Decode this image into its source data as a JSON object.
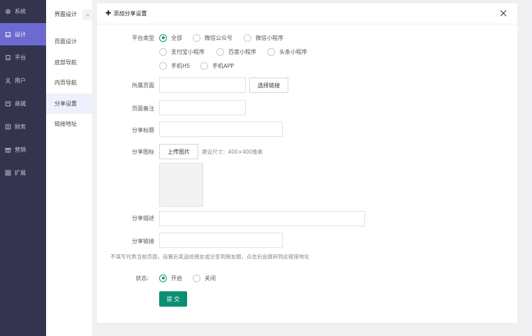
{
  "nav": [
    {
      "label": "系统",
      "icon": "gear-icon"
    },
    {
      "label": "设计",
      "icon": "design-icon",
      "active": true
    },
    {
      "label": "平台",
      "icon": "platform-icon"
    },
    {
      "label": "用户",
      "icon": "user-icon"
    },
    {
      "label": "商城",
      "icon": "shop-icon"
    },
    {
      "label": "财务",
      "icon": "finance-icon"
    },
    {
      "label": "营销",
      "icon": "gift-icon"
    },
    {
      "label": "扩展",
      "icon": "grid-icon"
    }
  ],
  "submenu": {
    "title": "界面设计",
    "collapse_glyph": "«",
    "items": [
      {
        "label": "页面设计"
      },
      {
        "label": "底部导航"
      },
      {
        "label": "内页导航"
      },
      {
        "label": "分享设置",
        "active": true
      },
      {
        "label": "链接地址"
      }
    ]
  },
  "panel": {
    "title": "添加分享设置",
    "plus": "✚",
    "close": "✕"
  },
  "form": {
    "platform_label": "平台类型",
    "platform_options": [
      "全部",
      "微信公众号",
      "微信小程序",
      "支付宝小程序",
      "百度小程序",
      "头条小程序",
      "手机H5",
      "手机APP"
    ],
    "platform_selected": "全部",
    "page_label": "所属页面",
    "page_value": "",
    "select_link_button": "选择链接",
    "remark_label": "页面备注",
    "remark_value": "",
    "share_title_label": "分享标题",
    "share_title_value": "",
    "share_icon_label": "分享图标",
    "upload_button": "上传图片",
    "size_hint": "建议尺寸：400×400像素",
    "share_desc_label": "分享描述",
    "share_desc_value": "",
    "share_link_label": "分享链接",
    "share_link_value": "",
    "link_hint": "不填写代表当前页面，设置后发送给朋友或分享到朋友圈，点击后会跳转到此链接地址",
    "status_label": "状态:",
    "status_options": [
      "开启",
      "关闭"
    ],
    "status_selected": "开启",
    "submit_label": "提 交"
  },
  "colors": {
    "sidebar_bg": "#34344f",
    "sidebar_active": "#6a6ad0",
    "accent_green": "#0b8f73"
  }
}
